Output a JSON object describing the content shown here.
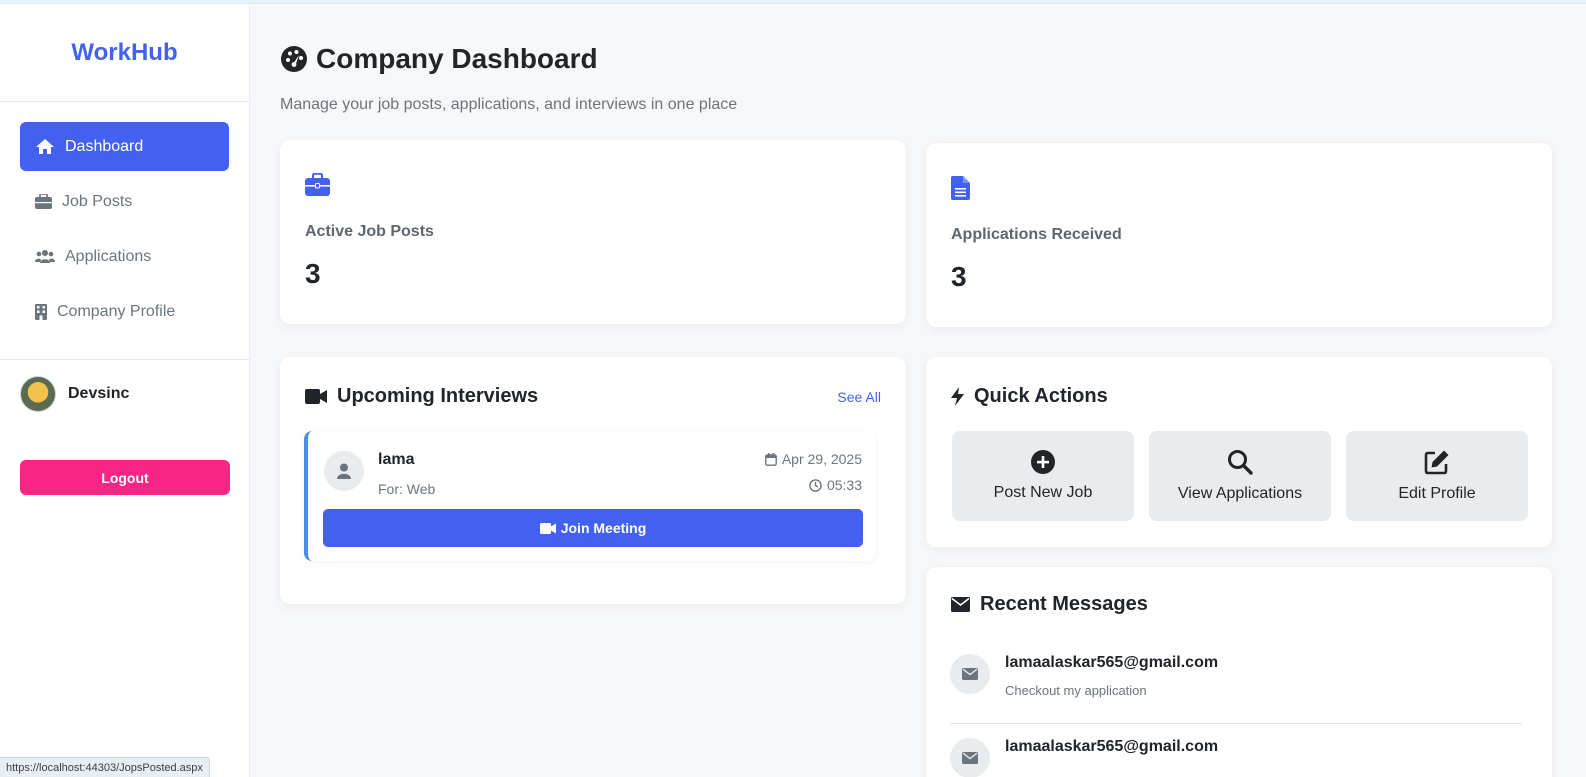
{
  "app": {
    "brand": "WorkHub",
    "accent": "#4361ee",
    "logout_color": "#f72585"
  },
  "sidebar": {
    "items": [
      {
        "label": "Dashboard",
        "icon": "home-icon",
        "active": true
      },
      {
        "label": "Job Posts",
        "icon": "briefcase-icon",
        "active": false
      },
      {
        "label": "Applications",
        "icon": "users-icon",
        "active": false
      },
      {
        "label": "Company Profile",
        "icon": "building-icon",
        "active": false
      }
    ],
    "user": {
      "name": "Devsinc"
    },
    "logout_label": "Logout"
  },
  "header": {
    "title": "Company Dashboard",
    "subtitle": "Manage your job posts, applications, and interviews in one place"
  },
  "stats": [
    {
      "label": "Active Job Posts",
      "value": "3",
      "icon": "briefcase-icon"
    },
    {
      "label": "Applications Received",
      "value": "3",
      "icon": "file-icon"
    }
  ],
  "interviews": {
    "title": "Upcoming Interviews",
    "see_all": "See All",
    "items": [
      {
        "name": "lama",
        "for": "For: Web",
        "date": "Apr 29, 2025",
        "time": "05:33",
        "join_label": "Join Meeting"
      }
    ]
  },
  "quick_actions": {
    "title": "Quick Actions",
    "buttons": [
      {
        "label": "Post New Job",
        "icon": "plus-circle-icon"
      },
      {
        "label": "View Applications",
        "icon": "search-icon"
      },
      {
        "label": "Edit Profile",
        "icon": "edit-icon"
      }
    ]
  },
  "messages": {
    "title": "Recent Messages",
    "items": [
      {
        "from": "lamaalaskar565@gmail.com",
        "text": "Checkout my application"
      },
      {
        "from": "lamaalaskar565@gmail.com",
        "text": ""
      }
    ]
  },
  "statusbar": {
    "url": "https://localhost:44303/JopsPosted.aspx"
  }
}
